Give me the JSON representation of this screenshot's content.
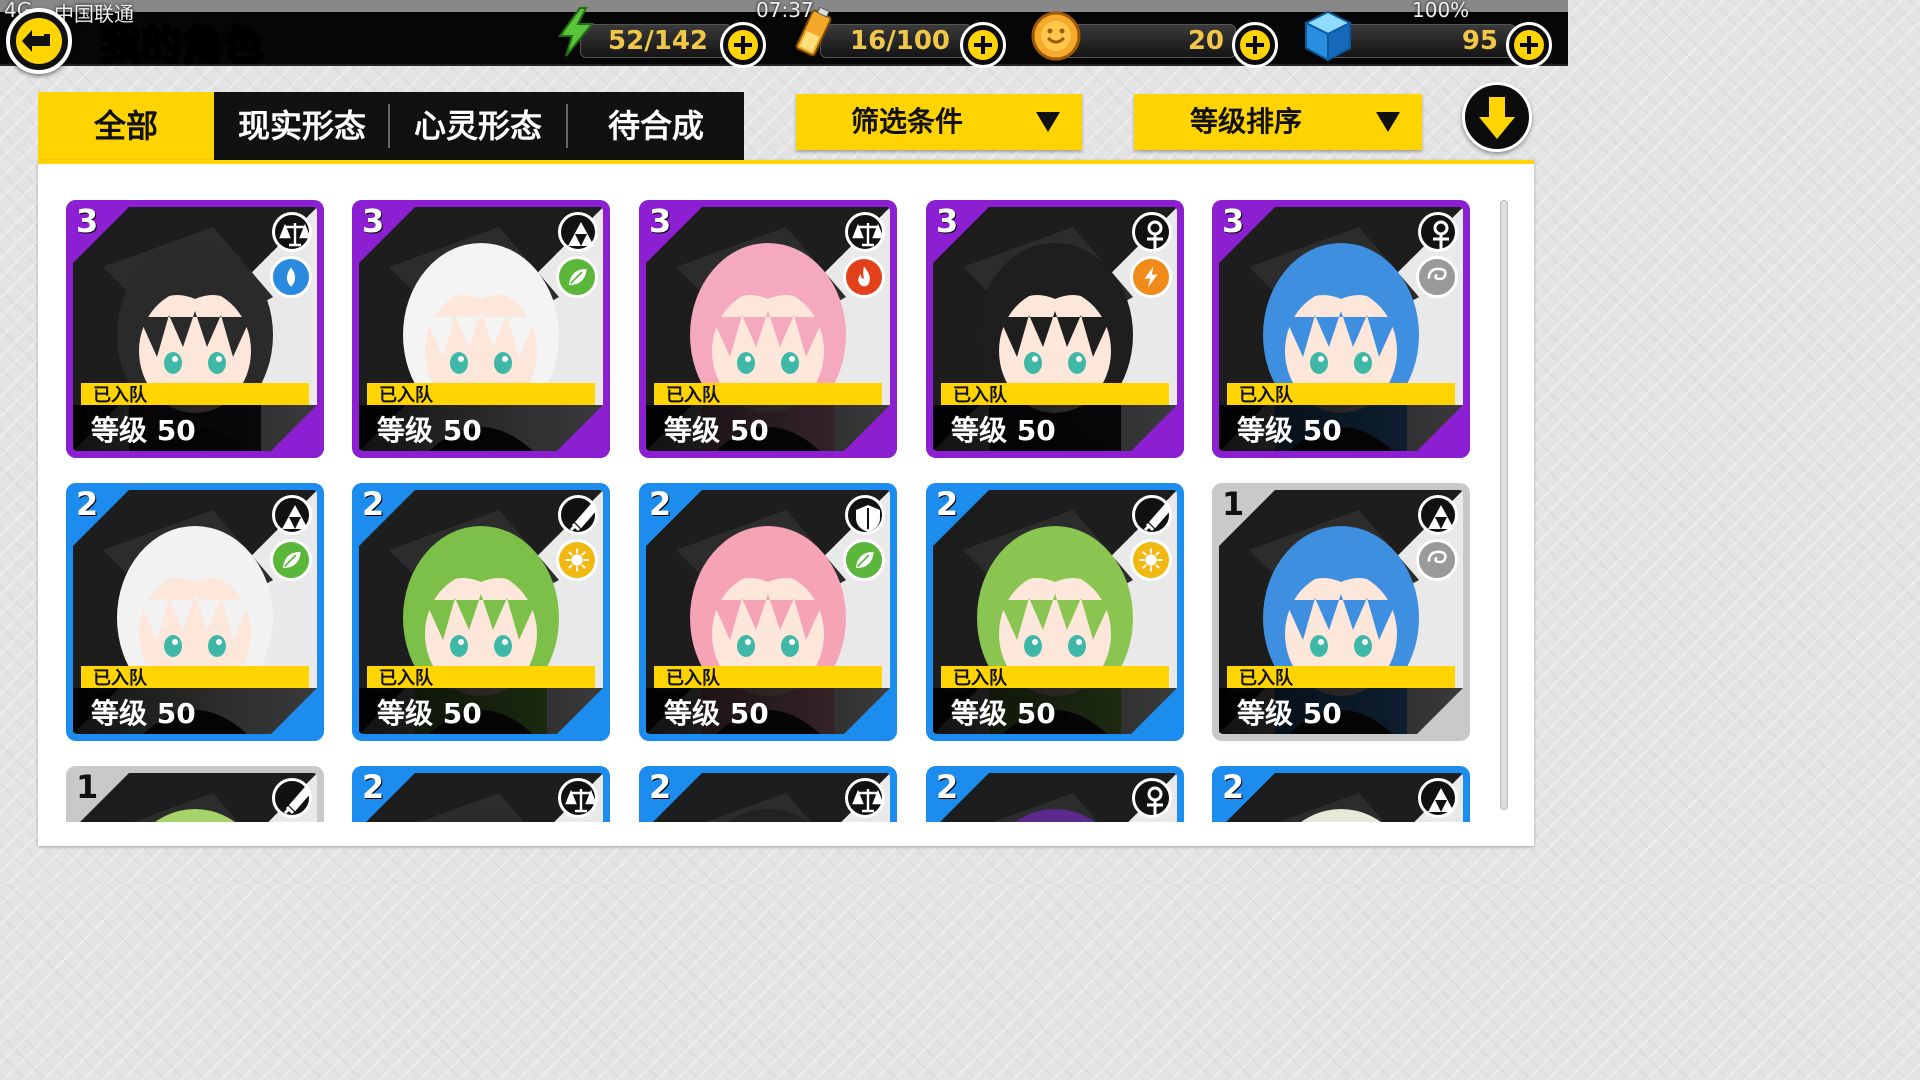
{
  "status_bar": {
    "signal": "4G",
    "carrier": "中国联通",
    "time": "07:37",
    "battery": "100%"
  },
  "header": {
    "title": "我的角色"
  },
  "resources": [
    {
      "name": "stamina",
      "icon": "lightning-icon",
      "value": "52/142"
    },
    {
      "name": "energy",
      "icon": "battery-icon",
      "value": "16/100"
    },
    {
      "name": "coins",
      "icon": "coin-icon",
      "value": "20"
    },
    {
      "name": "gems",
      "icon": "cube-icon",
      "value": "95"
    }
  ],
  "tabs": [
    {
      "label": "全部",
      "active": true
    },
    {
      "label": "现实形态",
      "active": false
    },
    {
      "label": "心灵形态",
      "active": false
    },
    {
      "label": "待合成",
      "active": false
    }
  ],
  "filters": {
    "filter_label": "筛选条件",
    "sort_label": "等级排序",
    "sort_direction_icon": "arrow-down-icon"
  },
  "colors": {
    "accent": "#ffd400",
    "rank3": "#8c1fd1",
    "rank2": "#1c8cee",
    "rank1": "#c9c9c9"
  },
  "characters": [
    {
      "rank": "3",
      "class_icon": "scales-icon",
      "element_icon": "water-drop-icon",
      "status": "已入队",
      "level": "等级 50",
      "hair": "#2a2a2a"
    },
    {
      "rank": "3",
      "class_icon": "triforce-icon",
      "element_icon": "leaf-icon",
      "status": "已入队",
      "level": "等级 50",
      "hair": "#f4f4f4"
    },
    {
      "rank": "3",
      "class_icon": "scales-icon",
      "element_icon": "flame-icon",
      "status": "已入队",
      "level": "等级 50",
      "hair": "#f4a9bf"
    },
    {
      "rank": "3",
      "class_icon": "ankh-icon",
      "element_icon": "lightning-bolt-icon",
      "status": "已入队",
      "level": "等级 50",
      "hair": "#1e1e1e"
    },
    {
      "rank": "3",
      "class_icon": "ankh-icon",
      "element_icon": "swirl-icon",
      "status": "已入队",
      "level": "等级 50",
      "hair": "#3f8fe0"
    },
    {
      "rank": "2",
      "class_icon": "triforce-icon",
      "element_icon": "leaf-icon",
      "status": "已入队",
      "level": "等级 50",
      "hair": "#f2f2f2"
    },
    {
      "rank": "2",
      "class_icon": "sword-icon",
      "element_icon": "sun-icon",
      "status": "已入队",
      "level": "等级 50",
      "hair": "#7cc04a"
    },
    {
      "rank": "2",
      "class_icon": "shield-icon",
      "element_icon": "leaf-icon",
      "status": "已入队",
      "level": "等级 50",
      "hair": "#f6a3b6"
    },
    {
      "rank": "2",
      "class_icon": "sword-icon",
      "element_icon": "sun-icon",
      "status": "已入队",
      "level": "等级 50",
      "hair": "#8ac552"
    },
    {
      "rank": "1",
      "class_icon": "triforce-icon",
      "element_icon": "swirl-icon",
      "status": "已入队",
      "level": "等级 50",
      "hair": "#3f8fe0"
    },
    {
      "rank": "1",
      "class_icon": "sword-icon",
      "hair": "#a6d36a"
    },
    {
      "rank": "2",
      "class_icon": "scales-icon",
      "hair": "#2a2a2a"
    },
    {
      "rank": "2",
      "class_icon": "scales-icon",
      "hair": "#222222"
    },
    {
      "rank": "2",
      "class_icon": "ankh-icon",
      "hair": "#5b2a8f"
    },
    {
      "rank": "2",
      "class_icon": "triforce-icon",
      "hair": "#e8e8d8"
    }
  ]
}
